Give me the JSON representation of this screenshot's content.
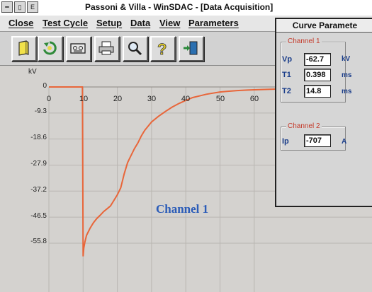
{
  "window": {
    "title": "Passoni & Villa - WinSDAC - [Data Acquisition]",
    "system_icon": "E"
  },
  "menu": [
    {
      "label": "Close"
    },
    {
      "label": "Test Cycle"
    },
    {
      "label": "Setup"
    },
    {
      "label": "Data"
    },
    {
      "label": "View"
    },
    {
      "label": "Parameters"
    }
  ],
  "toolbar": [
    {
      "icon": "open-file-icon"
    },
    {
      "icon": "refresh-acquire-icon"
    },
    {
      "icon": "tape-cassette-icon"
    },
    {
      "icon": "printer-icon"
    },
    {
      "icon": "magnifier-icon"
    },
    {
      "icon": "help-question-icon"
    },
    {
      "icon": "exit-door-icon"
    }
  ],
  "chart": {
    "y_unit": "kV",
    "y_ticks": [
      "0",
      "-9.3",
      "-18.6",
      "-27.9",
      "-37.2",
      "-46.5",
      "-55.8"
    ],
    "x_ticks": [
      "0",
      "10",
      "20",
      "30",
      "40",
      "50",
      "60"
    ],
    "channel_label": "Channel 1",
    "trace_color": "#e8663a"
  },
  "chart_data": {
    "type": "line",
    "series": [
      {
        "name": "Channel 1",
        "x": [
          0,
          9,
          9.8,
          10,
          10.2,
          10.5,
          11,
          12,
          13,
          14,
          15,
          16,
          17,
          18,
          19,
          20,
          21,
          22,
          23,
          24,
          25,
          26,
          27,
          28,
          30,
          32,
          34,
          36,
          38,
          40,
          42,
          44,
          46,
          48,
          50,
          52,
          55,
          58,
          60,
          65,
          70,
          75,
          80
        ],
        "y": [
          0,
          0,
          0,
          -60.5,
          -57.5,
          -55.5,
          -53,
          -50.5,
          -48.5,
          -47,
          -45.8,
          -44.5,
          -43.5,
          -42.5,
          -40.5,
          -38.5,
          -36,
          -31,
          -27,
          -24.5,
          -22,
          -20,
          -17.5,
          -15.5,
          -12.5,
          -10.5,
          -8.8,
          -7.2,
          -5.9,
          -4.8,
          -3.8,
          -3.2,
          -2.6,
          -2.2,
          -1.8,
          -1.6,
          -1.3,
          -1.1,
          -1.0,
          -0.8,
          -0.6,
          -0.45,
          -0.3
        ]
      }
    ],
    "x_ticks": [
      0,
      10,
      20,
      30,
      40,
      50,
      60
    ],
    "y_ticks": [
      0,
      -9.3,
      -18.6,
      -27.9,
      -37.2,
      -46.5,
      -55.8
    ],
    "ylim": [
      -62,
      0
    ],
    "ylabel": "kV",
    "grid": true
  },
  "params": {
    "title": "Curve Paramete",
    "channel1": {
      "title": "Channel 1",
      "fields": [
        {
          "label": "Vp",
          "value": "-62.7",
          "unit": "kV"
        },
        {
          "label": "T1",
          "value": "0.398",
          "unit": "ms"
        },
        {
          "label": "T2",
          "value": "14.8",
          "unit": "ms"
        }
      ]
    },
    "channel2": {
      "title": "Channel 2",
      "fields": [
        {
          "label": "Ip",
          "value": "-707",
          "unit": "A"
        }
      ]
    }
  }
}
